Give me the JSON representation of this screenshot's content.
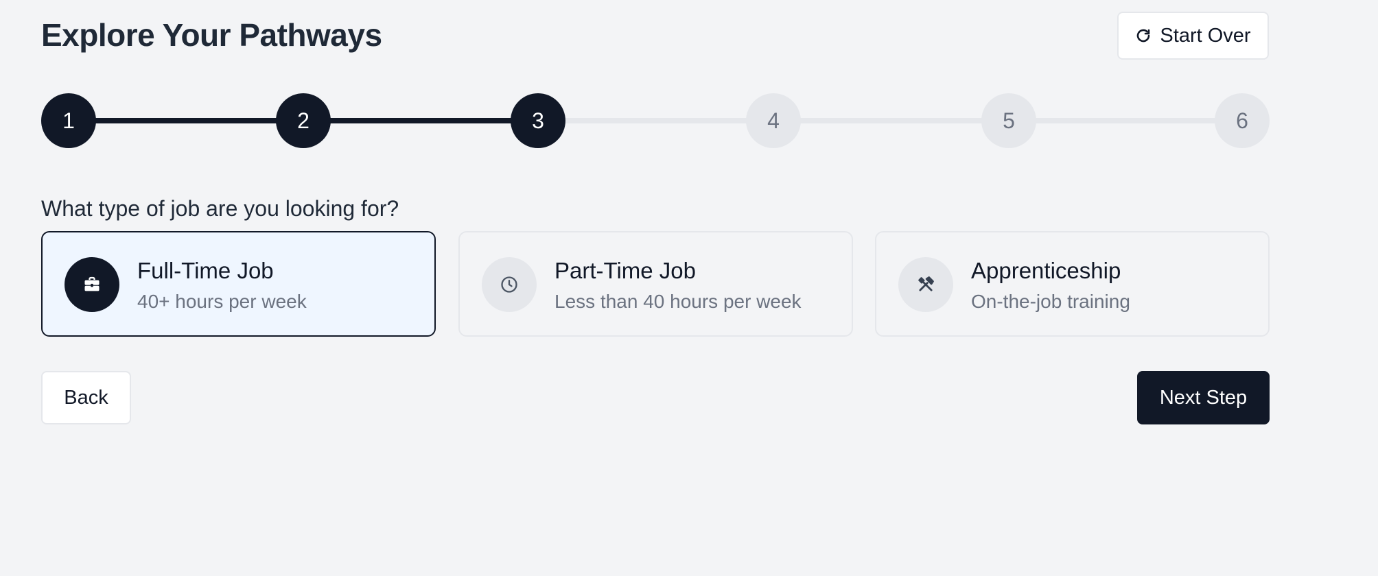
{
  "header": {
    "title": "Explore Your Pathways",
    "start_over_label": "Start Over",
    "start_over_icon": "refresh-icon"
  },
  "stepper": {
    "current_step": 3,
    "steps": [
      "1",
      "2",
      "3",
      "4",
      "5",
      "6"
    ]
  },
  "question": "What type of job are you looking for?",
  "options": [
    {
      "title": "Full-Time Job",
      "subtitle": "40+ hours per week",
      "icon": "briefcase-icon",
      "selected": true
    },
    {
      "title": "Part-Time Job",
      "subtitle": "Less than 40 hours per week",
      "icon": "clock-icon",
      "selected": false
    },
    {
      "title": "Apprenticeship",
      "subtitle": "On-the-job training",
      "icon": "tools-icon",
      "selected": false
    }
  ],
  "footer": {
    "back_label": "Back",
    "next_label": "Next Step"
  },
  "colors": {
    "accent": "#111827",
    "selected_bg": "#eff6ff",
    "inactive": "#e5e7eb",
    "background": "#f3f4f6"
  }
}
